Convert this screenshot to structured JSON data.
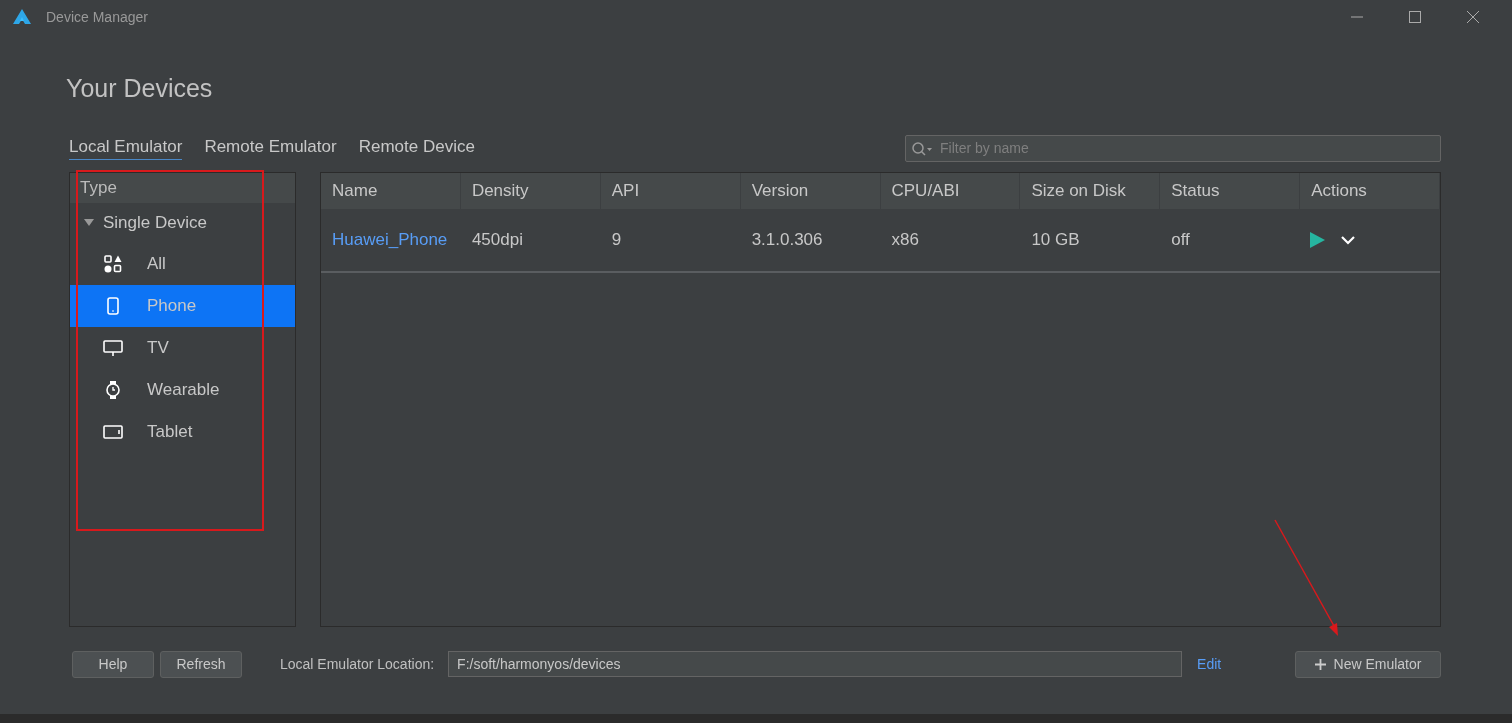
{
  "window": {
    "title": "Device Manager"
  },
  "heading": "Your Devices",
  "tabs": [
    {
      "label": "Local Emulator",
      "selected": true
    },
    {
      "label": "Remote Emulator",
      "selected": false
    },
    {
      "label": "Remote Device",
      "selected": false
    }
  ],
  "search": {
    "placeholder": "Filter by name"
  },
  "sidebar": {
    "header": "Type",
    "group": {
      "label": "Single Device",
      "expanded": true,
      "children": [
        {
          "label": "All",
          "kind": "all",
          "selected": false
        },
        {
          "label": "Phone",
          "kind": "phone",
          "selected": true
        },
        {
          "label": "TV",
          "kind": "tv",
          "selected": false
        },
        {
          "label": "Wearable",
          "kind": "wearable",
          "selected": false
        },
        {
          "label": "Tablet",
          "kind": "tablet",
          "selected": false
        }
      ]
    }
  },
  "table": {
    "columns": [
      "Name",
      "Density",
      "API",
      "Version",
      "CPU/ABI",
      "Size on Disk",
      "Status",
      "Actions"
    ],
    "rows": [
      {
        "cells": [
          "Huawei_Phone",
          "450dpi",
          "9",
          "3.1.0.306",
          "x86",
          "10 GB",
          "off"
        ]
      }
    ]
  },
  "footer": {
    "buttons": [
      "Help",
      "Refresh"
    ],
    "location_label": "Local Emulator Location:",
    "location_value": "F:/soft/harmonyos/devices",
    "edit_link": "Edit",
    "new_button": "New Emulator"
  }
}
